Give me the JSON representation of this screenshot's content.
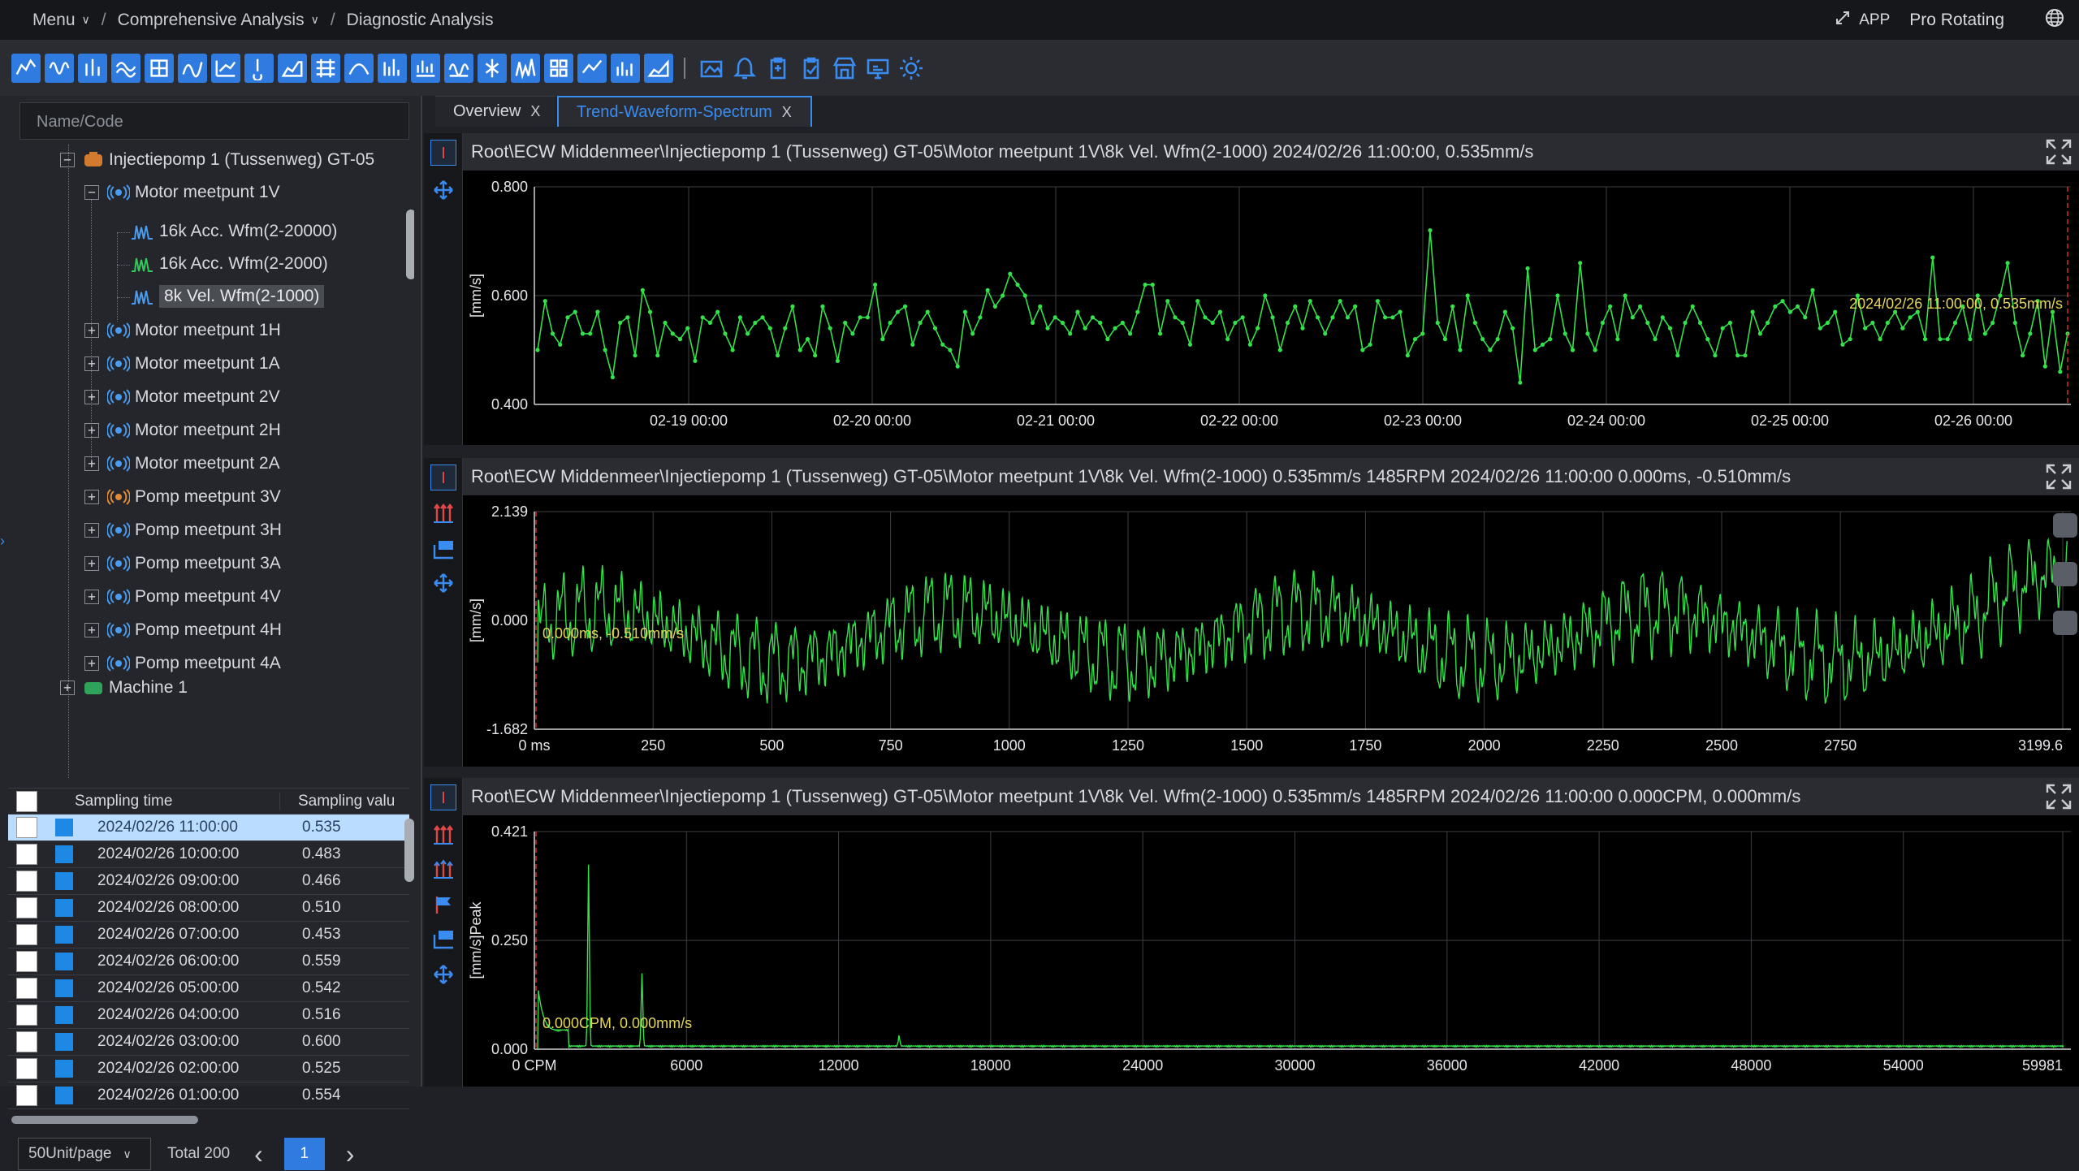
{
  "breadcrumb": {
    "menu": "Menu",
    "level1": "Comprehensive Analysis",
    "current": "Diagnostic Analysis",
    "separator": "/"
  },
  "topright": {
    "app_label": "APP",
    "product": "Pro Rotating"
  },
  "toolbar": {
    "left_icons": [
      "trend-icon",
      "waveform-icon",
      "spectrum-icon",
      "waterfall-icon",
      "orbit-icon",
      "envelope-icon",
      "bode-icon",
      "thermo-icon",
      "cascade-icon",
      "grid-chart-icon",
      "polar-icon",
      "shaft-icon",
      "bar-icon",
      "wave2-icon",
      "scatter-icon",
      "fft-icon",
      "tiles-icon",
      "line-icon",
      "column-icon",
      "area-icon"
    ],
    "right_icons": [
      "image-icon",
      "bell-icon",
      "clipboard-icon",
      "checklist-icon",
      "store-icon",
      "monitor-icon",
      "gear-icon"
    ]
  },
  "search": {
    "placeholder": "Name/Code"
  },
  "tree": {
    "pump": "Injectiepomp 1 (Tussenweg) GT-05",
    "motor_1v": "Motor meetpunt 1V",
    "ch1": "16k Acc. Wfm(2-20000)",
    "ch2": "16k Acc. Wfm(2-2000)",
    "ch3": "8k Vel. Wfm(2-1000)",
    "points": [
      "Motor meetpunt 1H",
      "Motor meetpunt 1A",
      "Motor meetpunt 2V",
      "Motor meetpunt 2H",
      "Motor meetpunt 2A",
      "Pomp meetpunt 3V",
      "Pomp meetpunt 3H",
      "Pomp meetpunt 3A",
      "Pomp meetpunt 4V",
      "Pomp meetpunt 4H",
      "Pomp meetpunt 4A"
    ],
    "machine": "Machine 1"
  },
  "samples": {
    "col_time": "Sampling time",
    "col_value": "Sampling valu",
    "rows": [
      {
        "time": "2024/02/26 11:00:00",
        "value": "0.535"
      },
      {
        "time": "2024/02/26 10:00:00",
        "value": "0.483"
      },
      {
        "time": "2024/02/26 09:00:00",
        "value": "0.466"
      },
      {
        "time": "2024/02/26 08:00:00",
        "value": "0.510"
      },
      {
        "time": "2024/02/26 07:00:00",
        "value": "0.453"
      },
      {
        "time": "2024/02/26 06:00:00",
        "value": "0.559"
      },
      {
        "time": "2024/02/26 05:00:00",
        "value": "0.542"
      },
      {
        "time": "2024/02/26 04:00:00",
        "value": "0.516"
      },
      {
        "time": "2024/02/26 03:00:00",
        "value": "0.600"
      },
      {
        "time": "2024/02/26 02:00:00",
        "value": "0.525"
      },
      {
        "time": "2024/02/26 01:00:00",
        "value": "0.554"
      }
    ]
  },
  "pager": {
    "page_size": "50Unit/page",
    "total": "Total 200",
    "prev": "‹",
    "next": "›",
    "page": "1"
  },
  "tabs": {
    "overview": "Overview",
    "trend": "Trend-Waveform-Spectrum",
    "close": "X"
  },
  "panes": {
    "trend_title": "Root\\ECW Middenmeer\\Injectiepomp 1 (Tussenweg) GT-05\\Motor meetpunt 1V\\8k Vel. Wfm(2-1000)  2024/02/26 11:00:00,  0.535mm/s",
    "wave_title": "Root\\ECW Middenmeer\\Injectiepomp 1 (Tussenweg) GT-05\\Motor meetpunt 1V\\8k Vel. Wfm(2-1000) 0.535mm/s 1485RPM 2024/02/26 11:00:00 0.000ms,  -0.510mm/s",
    "spec_title": "Root\\ECW Middenmeer\\Injectiepomp 1 (Tussenweg) GT-05\\Motor meetpunt 1V\\8k Vel. Wfm(2-1000) 0.535mm/s 1485RPM 2024/02/26 11:00:00 0.000CPM,  0.000mm/s"
  },
  "colors": {
    "accent": "#3a8cf0",
    "trace": "#33e14a",
    "annotation": "#e3d65a",
    "cursor": "#ff3a3a"
  },
  "chart_data": [
    {
      "type": "line",
      "ylabel": "[mm/s]",
      "ylim": [
        0.4,
        0.8
      ],
      "yticks": [
        "0.800",
        "0.600",
        "0.400"
      ],
      "xticks": [
        "02-19 00:00",
        "02-20 00:00",
        "02-21 00:00",
        "02-22 00:00",
        "02-23 00:00",
        "02-24 00:00",
        "02-25 00:00",
        "02-26 00:00"
      ],
      "annotation": "2024/02/26 11:00:00,  0.535mm/s",
      "grid": true,
      "values": [
        0.5,
        0.59,
        0.53,
        0.51,
        0.56,
        0.57,
        0.53,
        0.53,
        0.57,
        0.5,
        0.45,
        0.55,
        0.56,
        0.49,
        0.61,
        0.57,
        0.49,
        0.55,
        0.53,
        0.52,
        0.54,
        0.48,
        0.56,
        0.55,
        0.57,
        0.53,
        0.5,
        0.56,
        0.53,
        0.55,
        0.56,
        0.54,
        0.49,
        0.54,
        0.58,
        0.5,
        0.52,
        0.49,
        0.58,
        0.54,
        0.48,
        0.55,
        0.53,
        0.56,
        0.56,
        0.62,
        0.52,
        0.55,
        0.57,
        0.58,
        0.51,
        0.55,
        0.57,
        0.54,
        0.51,
        0.5,
        0.47,
        0.57,
        0.53,
        0.56,
        0.61,
        0.58,
        0.6,
        0.64,
        0.62,
        0.6,
        0.55,
        0.58,
        0.54,
        0.56,
        0.55,
        0.53,
        0.57,
        0.54,
        0.56,
        0.55,
        0.52,
        0.54,
        0.55,
        0.53,
        0.57,
        0.62,
        0.62,
        0.53,
        0.59,
        0.56,
        0.55,
        0.51,
        0.59,
        0.56,
        0.55,
        0.57,
        0.52,
        0.55,
        0.56,
        0.51,
        0.54,
        0.6,
        0.56,
        0.5,
        0.55,
        0.58,
        0.54,
        0.59,
        0.56,
        0.53,
        0.56,
        0.59,
        0.56,
        0.58,
        0.5,
        0.51,
        0.59,
        0.56,
        0.56,
        0.57,
        0.49,
        0.52,
        0.53,
        0.72,
        0.55,
        0.52,
        0.58,
        0.5,
        0.6,
        0.55,
        0.52,
        0.5,
        0.52,
        0.57,
        0.54,
        0.44,
        0.65,
        0.5,
        0.51,
        0.52,
        0.6,
        0.53,
        0.5,
        0.66,
        0.53,
        0.5,
        0.55,
        0.58,
        0.52,
        0.6,
        0.56,
        0.58,
        0.55,
        0.52,
        0.56,
        0.54,
        0.49,
        0.55,
        0.58,
        0.55,
        0.52,
        0.49,
        0.54,
        0.55,
        0.49,
        0.49,
        0.57,
        0.53,
        0.55,
        0.58,
        0.59,
        0.57,
        0.58,
        0.56,
        0.61,
        0.54,
        0.55,
        0.57,
        0.51,
        0.52,
        0.6,
        0.54,
        0.55,
        0.52,
        0.55,
        0.57,
        0.54,
        0.56,
        0.57,
        0.52,
        0.67,
        0.52,
        0.52,
        0.55,
        0.58,
        0.52,
        0.6,
        0.53,
        0.55,
        0.6,
        0.66,
        0.55,
        0.49,
        0.53,
        0.59,
        0.47,
        0.57,
        0.46,
        0.53
      ]
    },
    {
      "type": "line",
      "ylabel": "[mm/s]",
      "ylim": [
        -1.682,
        2.139
      ],
      "yticks": [
        "2.139",
        "0.000",
        "-1.682"
      ],
      "xlim": [
        0,
        3199.6
      ],
      "xticks": [
        "0 ms",
        "250",
        "500",
        "750",
        "1000",
        "1250",
        "1500",
        "1750",
        "2000",
        "2250",
        "2500",
        "2750",
        "3199.6"
      ],
      "annotation": "0.000ms,  -0.510mm/s",
      "grid": true
    },
    {
      "type": "line",
      "ylabel": "[mm/s]Peak",
      "ylim": [
        0,
        0.421
      ],
      "yticks": [
        "0.421",
        "0.250",
        "0.000"
      ],
      "xlim": [
        0,
        59981
      ],
      "xticks": [
        "0 CPM",
        "6000",
        "12000",
        "18000",
        "24000",
        "30000",
        "36000",
        "42000",
        "48000",
        "54000",
        "59981"
      ],
      "annotation": "0.000CPM,  0.000mm/s",
      "grid": true,
      "peaks": [
        {
          "x": 2000,
          "y": 0.35
        },
        {
          "x": 4100,
          "y": 0.14
        },
        {
          "x": 14200,
          "y": 0.02
        }
      ]
    }
  ]
}
